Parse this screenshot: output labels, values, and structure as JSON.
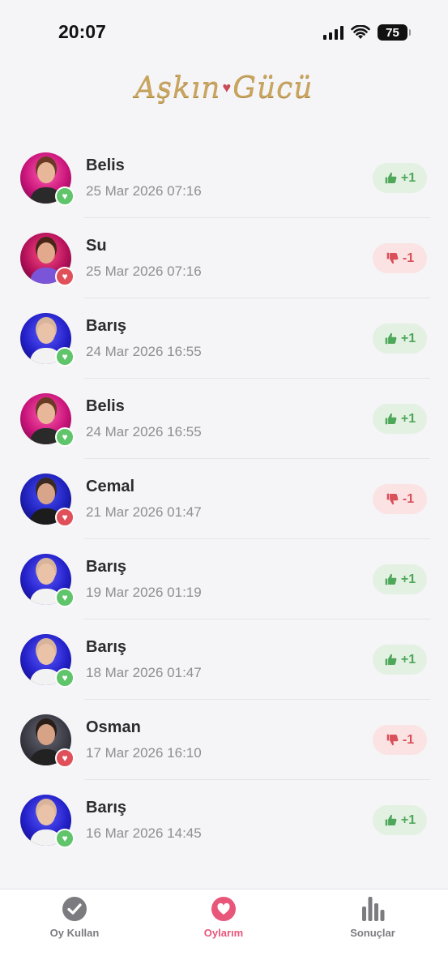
{
  "status_bar": {
    "time": "20:07",
    "battery": "75"
  },
  "app": {
    "logo_text_1": "Aşkın",
    "logo_text_2": "Gücü"
  },
  "votes": [
    {
      "name": "Belis",
      "date": "25 Mar 2026 07:16",
      "delta": "+1",
      "type": "up",
      "avatar": "belis"
    },
    {
      "name": "Su",
      "date": "25 Mar 2026 07:16",
      "delta": "-1",
      "type": "down",
      "avatar": "su"
    },
    {
      "name": "Barış",
      "date": "24 Mar 2026 16:55",
      "delta": "+1",
      "type": "up",
      "avatar": "baris"
    },
    {
      "name": "Belis",
      "date": "24 Mar 2026 16:55",
      "delta": "+1",
      "type": "up",
      "avatar": "belis"
    },
    {
      "name": "Cemal",
      "date": "21 Mar 2026 01:47",
      "delta": "-1",
      "type": "down",
      "avatar": "cemal"
    },
    {
      "name": "Barış",
      "date": "19 Mar 2026 01:19",
      "delta": "+1",
      "type": "up",
      "avatar": "baris"
    },
    {
      "name": "Barış",
      "date": "18 Mar 2026 01:47",
      "delta": "+1",
      "type": "up",
      "avatar": "baris"
    },
    {
      "name": "Osman",
      "date": "17 Mar 2026 16:10",
      "delta": "-1",
      "type": "down",
      "avatar": "osman"
    },
    {
      "name": "Barış",
      "date": "16 Mar 2026 14:45",
      "delta": "+1",
      "type": "up",
      "avatar": "baris"
    }
  ],
  "tabs": [
    {
      "label": "Oy Kullan",
      "icon": "check-circle-icon",
      "active": false
    },
    {
      "label": "Oylarım",
      "icon": "heart-icon",
      "active": true
    },
    {
      "label": "Sonuçlar",
      "icon": "bar-chart-icon",
      "active": false
    }
  ],
  "colors": {
    "up": "#5fc46a",
    "down": "#e0505a",
    "active_tab": "#e8567a",
    "logo_gold": "#c9a55e"
  }
}
